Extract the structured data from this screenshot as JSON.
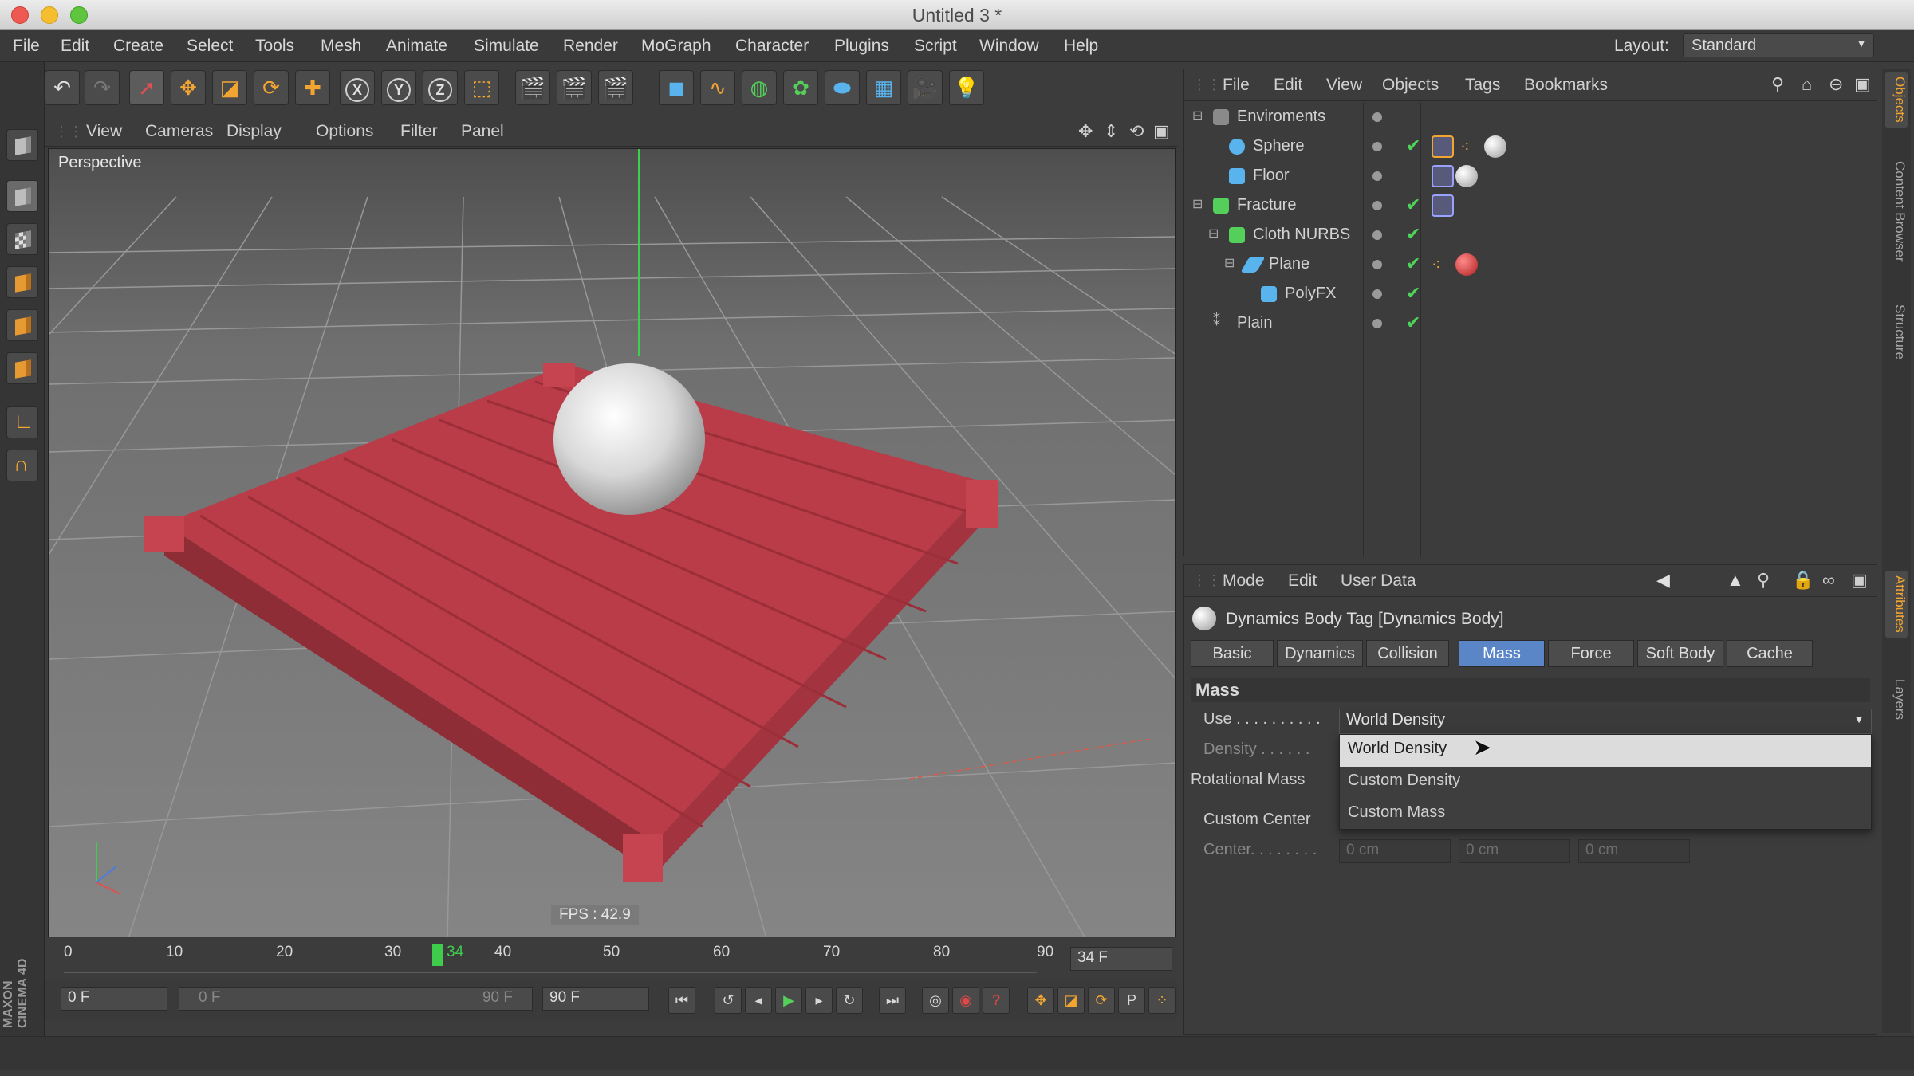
{
  "window": {
    "title": "Untitled 3 *"
  },
  "menubar": {
    "items": [
      "File",
      "Edit",
      "Create",
      "Select",
      "Tools",
      "Mesh",
      "Animate",
      "Simulate",
      "Render",
      "MoGraph",
      "Character",
      "Plugins",
      "Script",
      "Window",
      "Help"
    ],
    "layout_label": "Layout:",
    "layout_value": "Standard"
  },
  "viewport": {
    "menu": [
      "View",
      "Cameras",
      "Display",
      "Options",
      "Filter",
      "Panel"
    ],
    "camera_label": "Perspective",
    "fps": "FPS : 42.9"
  },
  "timeline": {
    "ticks": [
      "0",
      "10",
      "20",
      "30",
      "34",
      "40",
      "50",
      "60",
      "70",
      "80",
      "90"
    ],
    "current_frame_field": "34 F",
    "start_field": "0 F",
    "range_start": "0 F",
    "range_end": "90 F",
    "end_field": "90 F"
  },
  "object_manager": {
    "menu": [
      "File",
      "Edit",
      "View",
      "Objects",
      "Tags",
      "Bookmarks"
    ],
    "objects": [
      {
        "name": "Enviroments",
        "depth": 0,
        "icon_color": "#8a8a8a",
        "check": false
      },
      {
        "name": "Sphere",
        "depth": 1,
        "icon_color": "#59b4ee",
        "check": true
      },
      {
        "name": "Floor",
        "depth": 1,
        "icon_color": "#59b4ee",
        "check": false
      },
      {
        "name": "Fracture",
        "depth": 0,
        "icon_color": "#54d05a",
        "check": true
      },
      {
        "name": "Cloth NURBS",
        "depth": 1,
        "icon_color": "#54d05a",
        "check": true
      },
      {
        "name": "Plane",
        "depth": 2,
        "icon_color": "#59b4ee",
        "check": true
      },
      {
        "name": "PolyFX",
        "depth": 3,
        "icon_color": "#59b4ee",
        "check": true
      },
      {
        "name": "Plain",
        "depth": 0,
        "icon_color": "#8a8a8a",
        "check": true
      }
    ]
  },
  "attribute_manager": {
    "menu": [
      "Mode",
      "Edit",
      "User Data"
    ],
    "title": "Dynamics Body Tag [Dynamics Body]",
    "tabs": [
      "Basic",
      "Dynamics",
      "Collision",
      "Mass",
      "Force",
      "Soft Body",
      "Cache"
    ],
    "active_tab": "Mass",
    "section": "Mass",
    "use_label": "Use . . . . . . . . . .",
    "use_value": "World Density",
    "density_label": "Density . . . . . .",
    "rotational_mass_label": "Rotational Mass",
    "custom_center_label": "Custom Center",
    "center_label": "Center. . . . . . . .",
    "center_values": [
      "0 cm",
      "0 cm",
      "0 cm"
    ],
    "dropdown_options": [
      "World Density",
      "Custom Density",
      "Custom Mass"
    ],
    "highlighted_option": "World Density"
  },
  "side_tabs": [
    "Objects",
    "Content Browser",
    "Structure",
    "Attributes",
    "Layers"
  ],
  "branding": "MAXON CINEMA 4D",
  "colors": {
    "accent_blue": "#5a86c8",
    "check_green": "#4fd45a",
    "cloth_red": "#c8424e",
    "playhead_green": "#3fcc4d"
  }
}
